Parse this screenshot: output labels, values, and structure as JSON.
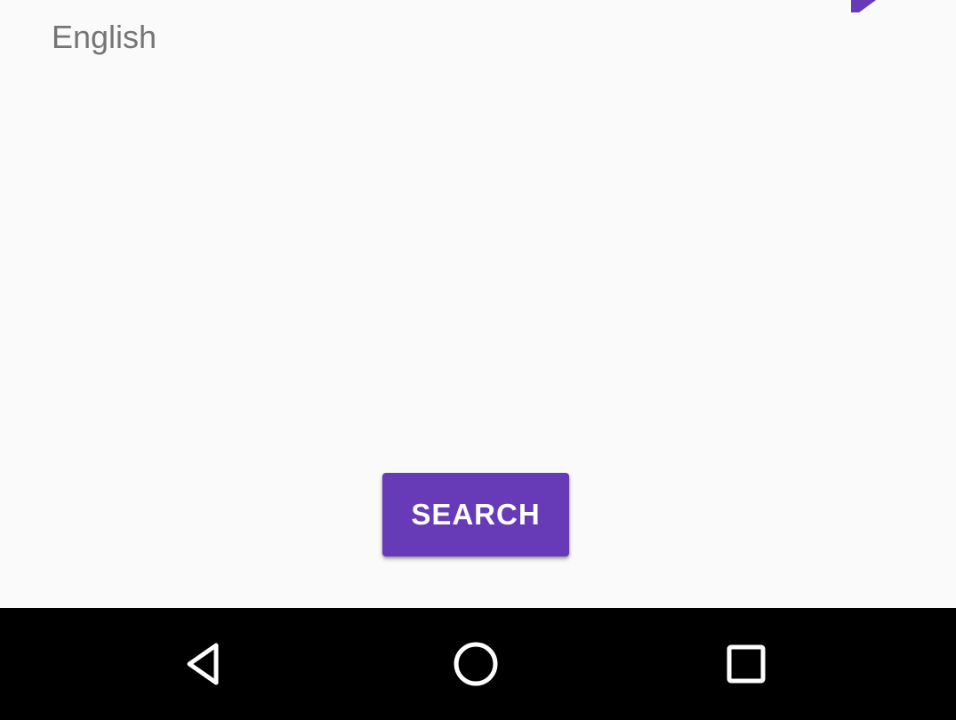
{
  "language": {
    "label": "English"
  },
  "edit": {
    "icon": "edit-pencil-icon"
  },
  "search_button": {
    "label": "SEARCH"
  },
  "navigation": {
    "back_icon": "back-triangle-icon",
    "home_icon": "home-circle-icon",
    "recents_icon": "recents-square-icon"
  },
  "colors": {
    "accent": "#673AB7",
    "background": "#FAFAFA",
    "label_text": "#757575",
    "nav_bar": "#000000"
  }
}
